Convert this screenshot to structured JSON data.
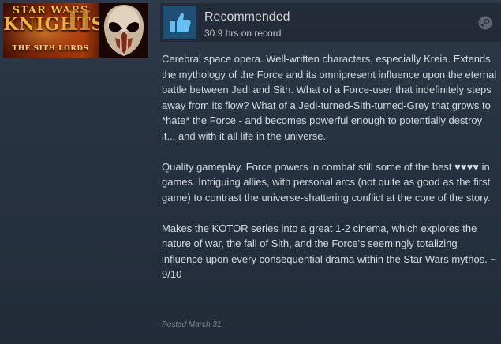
{
  "capsule": {
    "line1": "STAR WARS",
    "line2": "KNIGHTS",
    "numeral": "II",
    "subtitle": "THE SITH LORDS"
  },
  "review": {
    "status": "Recommended",
    "hours": "30.9 hrs on record",
    "paragraphs": [
      "Cerebral space opera. Well-written characters, especially Kreia. Extends the mythology of the Force and its omnipresent influence upon the eternal battle between Jedi and Sith. What of a Force-user that indefinitely steps away from its flow? What of a Jedi-turned-Sith-turned-Grey that grows to *hate* the Force - and becomes powerful enough to potentially destroy it... and with it all life in the universe.",
      "Quality gameplay. Force powers in combat still some of the best ♥♥♥♥ in games. Intriguing allies, with personal arcs (not quite as good as the first game) to contrast the universe-shattering conflict at the core of the story.",
      "Makes the KOTOR series into a great 1-2 cinema, which explores the nature of war, the fall of Sith, and the Force's seemingly totalizing influence upon every consequential drama within the Star Wars mythos. ~ 9/10"
    ],
    "posted": "Posted March 31."
  },
  "icons": {
    "thumb": "thumbs-up-icon",
    "platform": "steam-icon"
  },
  "colors": {
    "thumb_bg": "#1f4f72",
    "thumb_fg": "#66c0f4",
    "text": "#d4dbe1"
  }
}
